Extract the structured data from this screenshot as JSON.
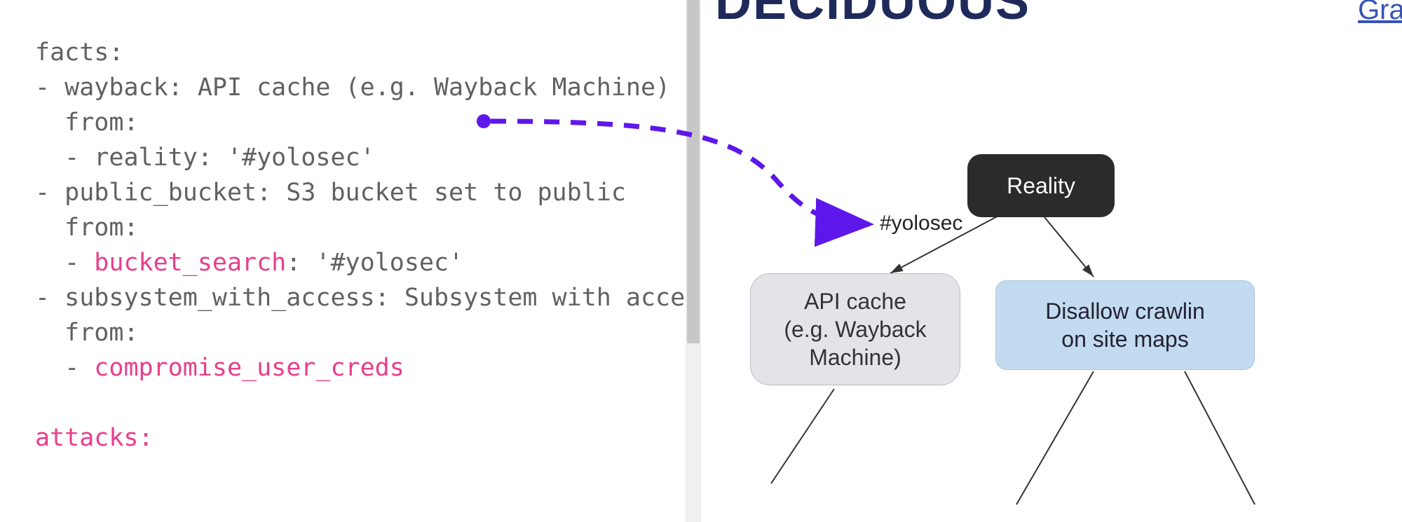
{
  "editor": {
    "lines": {
      "l0": "facts:",
      "l1_key": "wayback",
      "l1_val": "API cache (e.g. Wayback Machine)",
      "l2": "from:",
      "l3_key": "reality",
      "l3_val": "'#yolosec'",
      "l4_key": "public_bucket",
      "l4_val": "S3 bucket set to public",
      "l5": "from:",
      "l6_key": "bucket_search",
      "l6_val": "'#yolosec'",
      "l7_key": "subsystem_with_access",
      "l7_val": "Subsystem with acce",
      "l8": "from:",
      "l9_key": "compromise_user_creds",
      "l11": "attacks:"
    }
  },
  "brand": {
    "name": "DECIDUOUS",
    "link": "Grap"
  },
  "graph": {
    "edge_label_yolosec": "#yolosec",
    "node_reality": "Reality",
    "node_api_cache": "API cache\n(e.g. Wayback\nMachine)",
    "node_disallow": "Disallow crawlin\non site maps"
  }
}
